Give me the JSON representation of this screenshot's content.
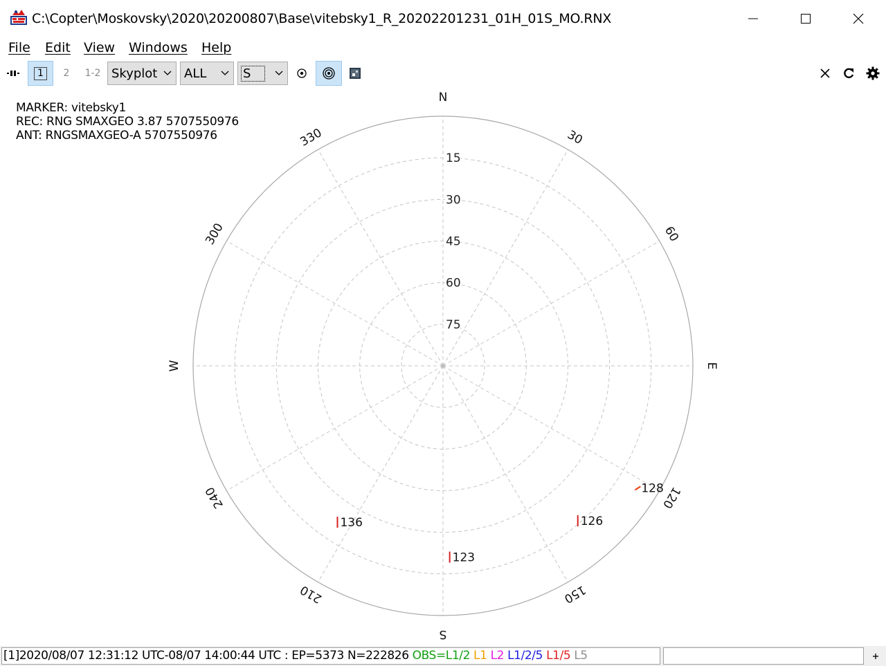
{
  "window": {
    "title": "C:\\Copter\\Moskovsky\\2020\\20200807\\Base\\vitebsky1_R_20202201231_01H_01S_MO.RNX",
    "app_icon": "app-icon"
  },
  "menu": [
    {
      "label": "File"
    },
    {
      "label": "Edit"
    },
    {
      "label": "View"
    },
    {
      "label": "Windows"
    },
    {
      "label": "Help"
    }
  ],
  "toolbar": {
    "pause_icon": "pause-icon",
    "plot1_label": "1",
    "plot2_label": "2",
    "plot12_label": "1-2",
    "plot_type": "Skyplot",
    "satellite_filter": "ALL",
    "obs_type": "S",
    "active_buttons": [
      "plot1",
      "target"
    ]
  },
  "info": {
    "marker": "MARKER: vitebsky1",
    "receiver": "REC: RNG SMAXGEO 3.87 5707550976",
    "antenna": "ANT: RNGSMAXGEO-A 5707550976"
  },
  "skyplot": {
    "cardinals": {
      "N": "N",
      "E": "E",
      "S": "S",
      "W": "W"
    },
    "azimuth_labels": [
      "30",
      "60",
      "120",
      "150",
      "210",
      "240",
      "300",
      "330"
    ],
    "elevation_labels": [
      "15",
      "30",
      "45",
      "60",
      "75"
    ],
    "satellites": [
      {
        "id": "128",
        "az": 122,
        "el": 7
      },
      {
        "id": "126",
        "az": 139,
        "el": 16
      },
      {
        "id": "123",
        "az": 178,
        "el": 21
      },
      {
        "id": "136",
        "az": 214,
        "el": 22
      }
    ],
    "track_color": "#e8491d",
    "tick_color": "#d62020"
  },
  "status": {
    "prefix": "[1]2020/08/07 12:31:12 UTC-08/07 14:00:44 UTC : EP=5373 N=222826 ",
    "obs_label": "OBS=L1/2",
    "l1": "L1",
    "l2": "L2",
    "l12_5": "L1/2/5",
    "l15": "L1/5",
    "l5": "L5",
    "colors": {
      "obs": "#12a012",
      "l1": "#f0a000",
      "l2": "#e020e0",
      "l125": "#2020e0",
      "l15": "#e02020",
      "l5": "#909090"
    }
  }
}
